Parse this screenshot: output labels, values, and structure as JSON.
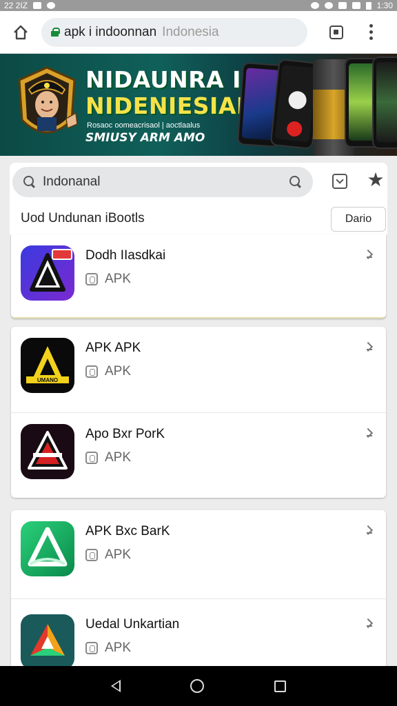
{
  "status_bar": {
    "time_left": "22 2IZ",
    "time_right": "1:30"
  },
  "browser": {
    "url_host": "apk i indoonnan",
    "url_path": "Indonesia"
  },
  "banner": {
    "line1": "NIDAUNRA II",
    "line2": "NIDENIESIAI",
    "line3": "Rosaoc oomeacrisaol | aoctlaalus",
    "line4": "SMIUSY ARM AMO"
  },
  "search": {
    "query": "Indonanal",
    "results_label": "Uod Undunan iBootls",
    "done_label": "Dario"
  },
  "apps": [
    {
      "name": "Dodh IIasdkai",
      "type": "APK"
    },
    {
      "name": "APK APK",
      "type": "APK"
    },
    {
      "name": "Apo Bxr PorK",
      "type": "APK"
    },
    {
      "name": "APK Bxc BarK",
      "type": "APK"
    },
    {
      "name": "Uedal Unkartian",
      "type": "APK"
    }
  ],
  "icons": {
    "home": "home-icon",
    "lock": "lock-icon",
    "tabs": "tabs-icon",
    "menu": "more-vert-icon",
    "search": "search-icon",
    "filter": "dropdown-icon",
    "star": "star-icon",
    "chevron": "chevron-right-icon"
  },
  "colors": {
    "banner_title": "#ffffff",
    "banner_title_accent": "#f5e24a",
    "lock": "#1a8a3a"
  }
}
